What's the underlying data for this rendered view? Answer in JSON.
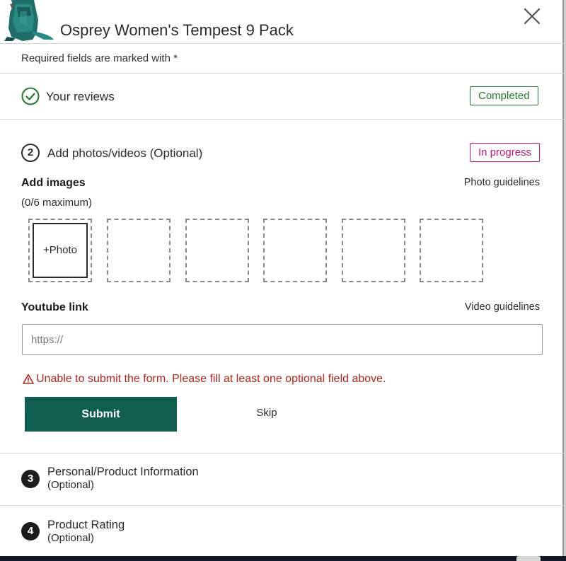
{
  "header": {
    "product_title": "Osprey Women's Tempest 9 Pack"
  },
  "required_note": "Required fields are marked with *",
  "steps": {
    "reviews": {
      "label": "Your reviews",
      "status": "Completed",
      "icon": "check-circle-icon"
    },
    "photos": {
      "number": "2",
      "label": "Add photos/videos (Optional)",
      "status": "In progress"
    },
    "personal": {
      "number": "3",
      "label": "Personal/Product Information",
      "sublabel": "(Optional)"
    },
    "rating": {
      "number": "4",
      "label": "Product Rating",
      "sublabel": "(Optional)"
    }
  },
  "images": {
    "heading": "Add images",
    "max_note": "(0/6 maximum)",
    "guidelines_link": "Photo guidelines",
    "add_label": "+Photo",
    "slots_count": 6
  },
  "youtube": {
    "heading": "Youtube link",
    "guidelines_link": "Video guidelines",
    "placeholder": "https://"
  },
  "error": {
    "message": "Unable to submit the form. Please fill at least one optional field above.",
    "icon": "warning-triangle-icon"
  },
  "actions": {
    "submit_label": "Submit",
    "skip_label": "Skip"
  },
  "colors": {
    "primary": "#0f5e50",
    "completed": "#1f7a2c",
    "in_progress": "#c2187a",
    "error": "#b3261e"
  }
}
